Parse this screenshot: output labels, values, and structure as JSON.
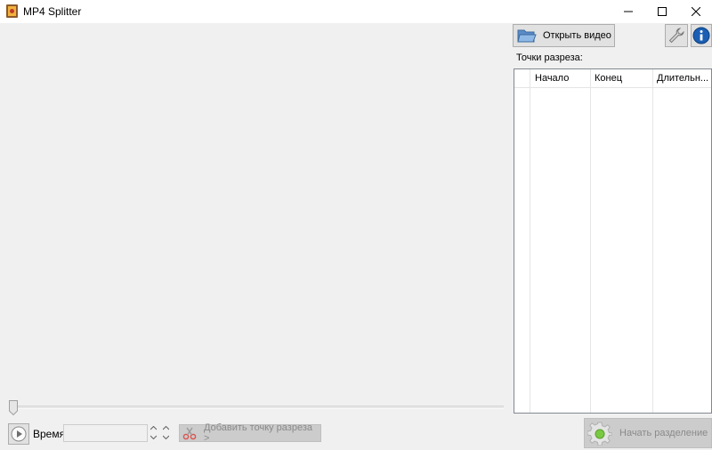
{
  "window": {
    "title": "MP4 Splitter"
  },
  "player": {
    "time_label": "Время:",
    "time_value": "",
    "add_cut_label": "Добавить точку разреза >"
  },
  "panel": {
    "open_video_label": "Открыть видео",
    "cuts_label": "Точки разреза:",
    "columns": [
      "",
      "Начало",
      "Конец",
      "Длительн..."
    ],
    "rows": [],
    "start_split_label": "Начать разделение"
  },
  "icons": {
    "app": "mp4-splitter-app-icon",
    "minimize": "minimize-icon",
    "maximize": "maximize-icon",
    "close": "close-icon",
    "play": "play-icon",
    "scissors": "scissors-icon",
    "folder": "open-folder-icon",
    "settings": "wrench-icon",
    "info": "info-icon",
    "gear": "gear-icon"
  },
  "colors": {
    "window_bg": "#f0f0f0",
    "titlebar_bg": "#ffffff",
    "info_blue": "#1a5fb4",
    "disabled_text": "#8a8a8a"
  }
}
